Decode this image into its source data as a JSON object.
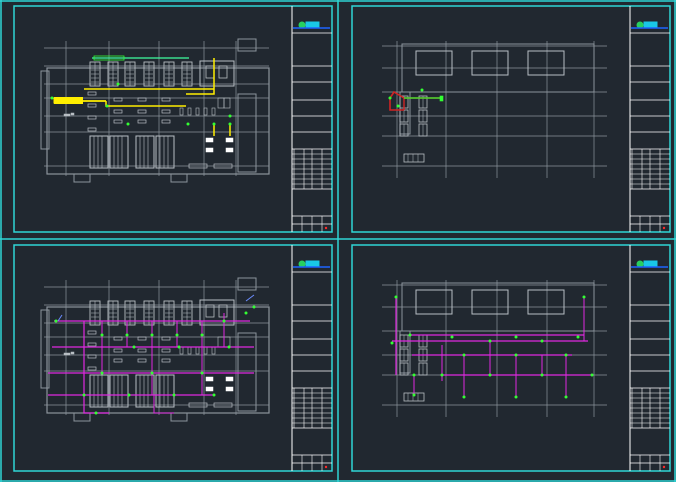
{
  "colors": {
    "background": "#212830",
    "frame": "#2fd6d6",
    "wall": "#8c949c",
    "equipment": "#b8bec4",
    "pipe_supply": "#ffee00",
    "pipe_drain": "#e029e0",
    "pipe_gas": "#d02424",
    "accent_green": "#33ff33",
    "logo_cyan": "#19c8e6",
    "logo_blue": "#1e64ff",
    "mark_red": "#ff2a2a"
  },
  "icons": {
    "title_block_logo": "company-logo-icon",
    "node": "pipe-node-icon"
  },
  "sheets": [
    {
      "id": "sheet-1",
      "layout": "plant-room",
      "pipe": "supply"
    },
    {
      "id": "sheet-2",
      "layout": "upper-floor",
      "pipe": "gas"
    },
    {
      "id": "sheet-3",
      "layout": "plant-room",
      "pipe": "drain"
    },
    {
      "id": "sheet-4",
      "layout": "upper-floor",
      "pipe": "drain"
    }
  ]
}
